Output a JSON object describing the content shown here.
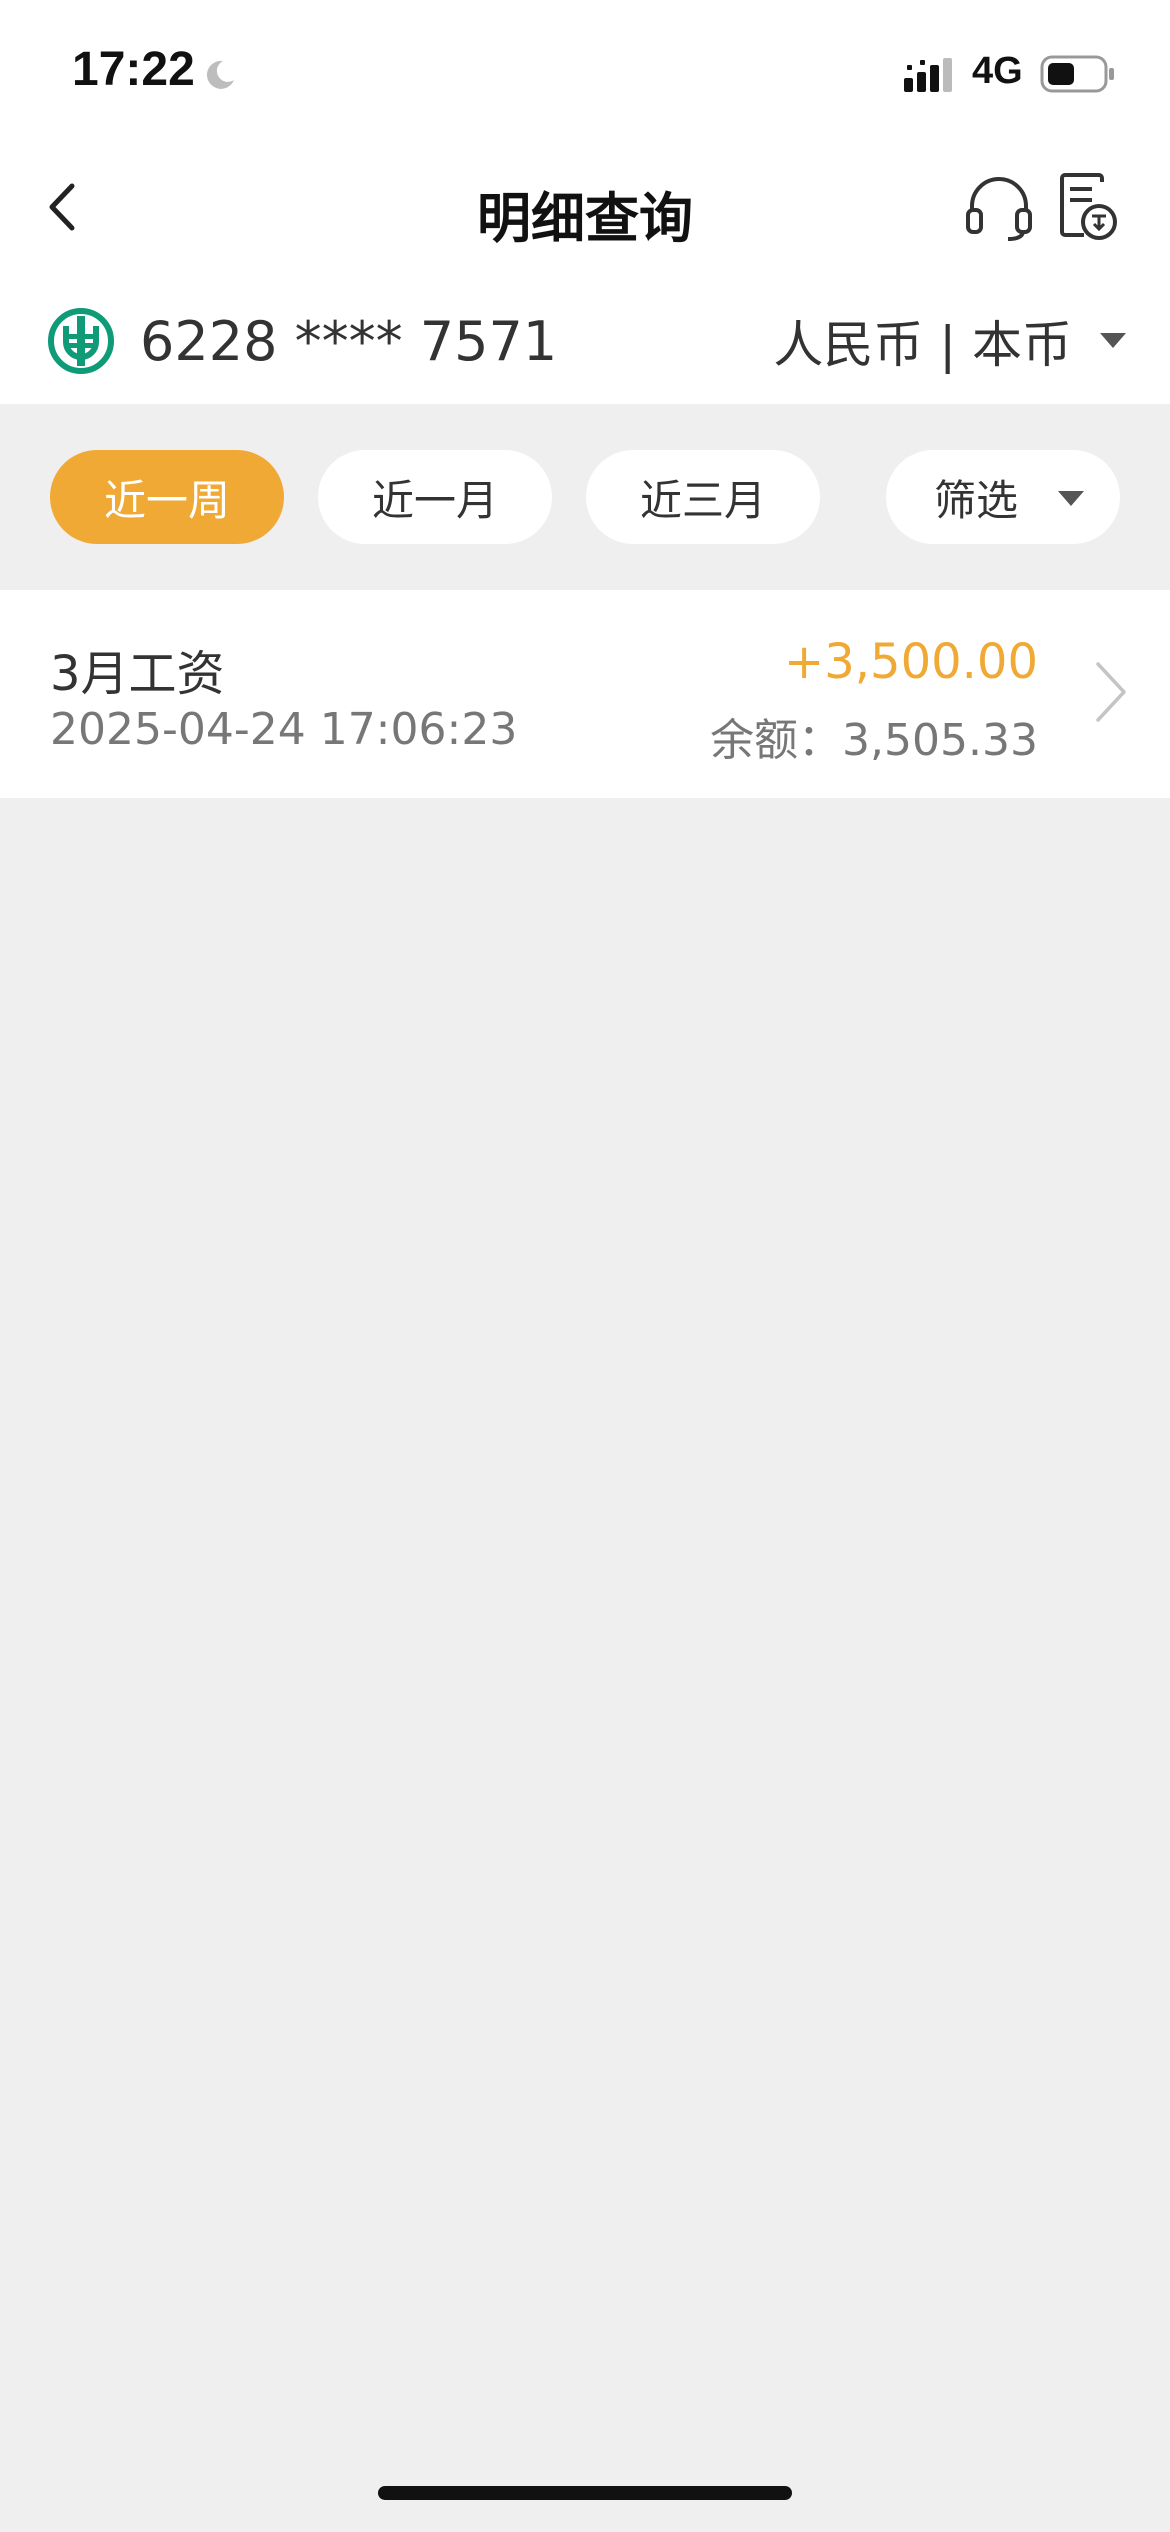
{
  "status_bar": {
    "time": "17:22",
    "network": "4G",
    "icons": [
      "moon-icon",
      "signal-icon",
      "battery-icon"
    ]
  },
  "nav": {
    "title": "明细查询",
    "icons": [
      "back-icon",
      "headset-icon",
      "export-icon"
    ]
  },
  "account": {
    "card_number": "6228 **** 7571",
    "currency": "人民币 | 本币",
    "icons": [
      "bank-logo-icon",
      "caret-down-icon"
    ]
  },
  "filters": {
    "items": [
      {
        "label": "近一周",
        "active": true
      },
      {
        "label": "近一月",
        "active": false
      },
      {
        "label": "近三月",
        "active": false
      }
    ],
    "filter_label": "筛选"
  },
  "transactions": [
    {
      "title": "3月工资",
      "datetime": "2025-04-24 17:06:23",
      "amount": "+3,500.00",
      "balance": "余额：3,505.33"
    }
  ],
  "colors": {
    "accent": "#f0a935",
    "background": "#efefef",
    "bank_green": "#0f9a78"
  }
}
